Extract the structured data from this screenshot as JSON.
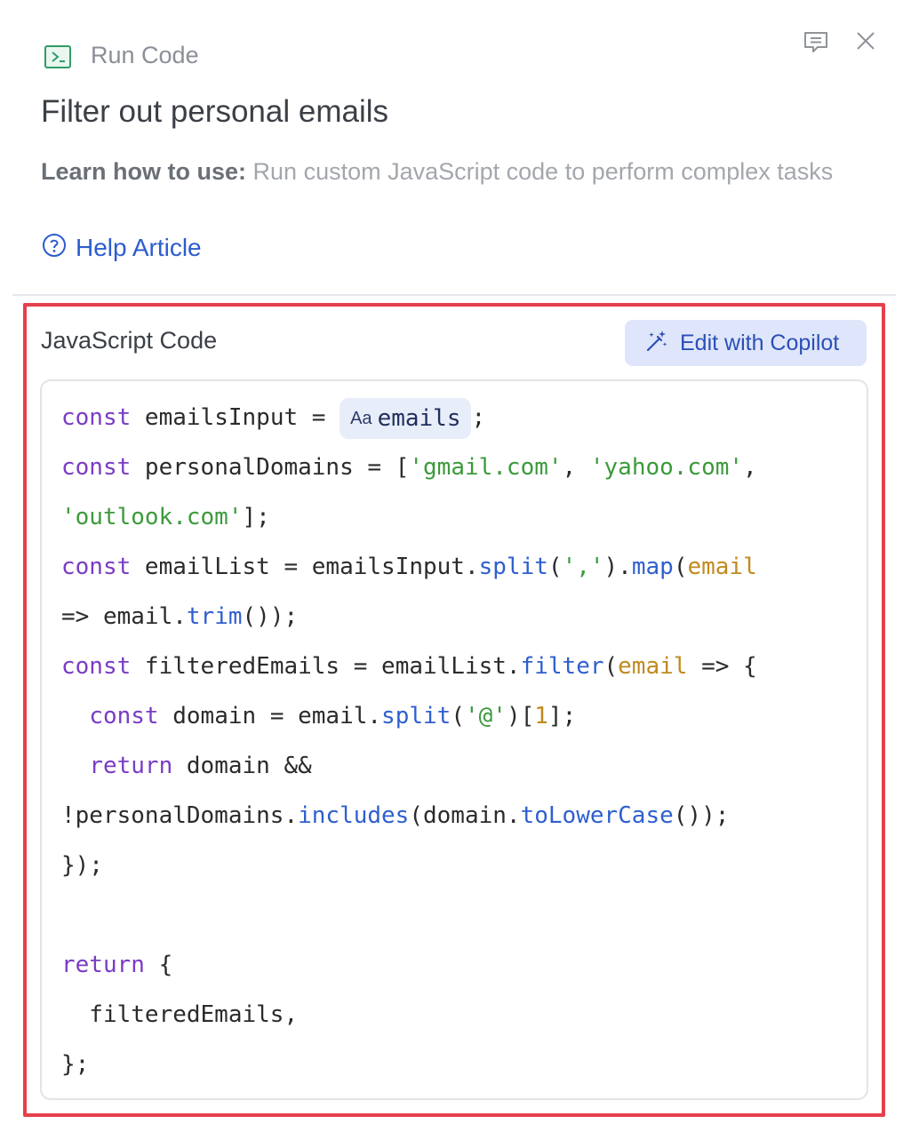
{
  "header": {
    "icon": "terminal-icon",
    "app_label": "Run Code",
    "comment_icon": "comment-icon",
    "close_icon": "close-icon"
  },
  "title": "Filter out personal emails",
  "description": {
    "prefix": "Learn how to use:",
    "text": " Run custom JavaScript code to perform complex tasks"
  },
  "help": {
    "icon": "question-circle-icon",
    "label": "Help Article"
  },
  "code_section": {
    "label": "JavaScript Code",
    "copilot_button": "Edit with Copilot",
    "copilot_icon": "magic-wand-icon",
    "variable_chip": {
      "icon": "Aa",
      "label": "emails"
    },
    "tokens": {
      "const": "const",
      "return": "return",
      "l1_a": " emailsInput = ",
      "l1_b": ";",
      "l2_a": " personalDomains = [",
      "gmail": "'gmail.com'",
      "comma_sp": ", ",
      "yahoo": "'yahoo.com'",
      "l2_end": ",",
      "outlook": "'outlook.com'",
      "l3_end": "];",
      "l4_a": " emailList = emailsInput.",
      "split": "split",
      "l4_b": "(",
      "comma_str": "','",
      "l4_c": ").",
      "map": "map",
      "l4_d": "(",
      "email_param": "email",
      "l5_a": "=> email.",
      "trim": "trim",
      "l5_b": "());",
      "l6_a": " filteredEmails = emailList.",
      "filter": "filter",
      "l6_b": "(",
      "l6_c": " => {",
      "indent": "  ",
      "l7_a": " domain = email.",
      "l7_b": "(",
      "at_str": "'@'",
      "l7_c": ")[",
      "one": "1",
      "l7_d": "];",
      "l8_a": " domain &&",
      "l9_a": "!personalDomains.",
      "includes": "includes",
      "l9_b": "(domain.",
      "tolower": "toLowerCase",
      "l9_c": "());",
      "l10": "});",
      "l12_a": " {",
      "l13": "  filteredEmails,",
      "l14": "};"
    }
  }
}
